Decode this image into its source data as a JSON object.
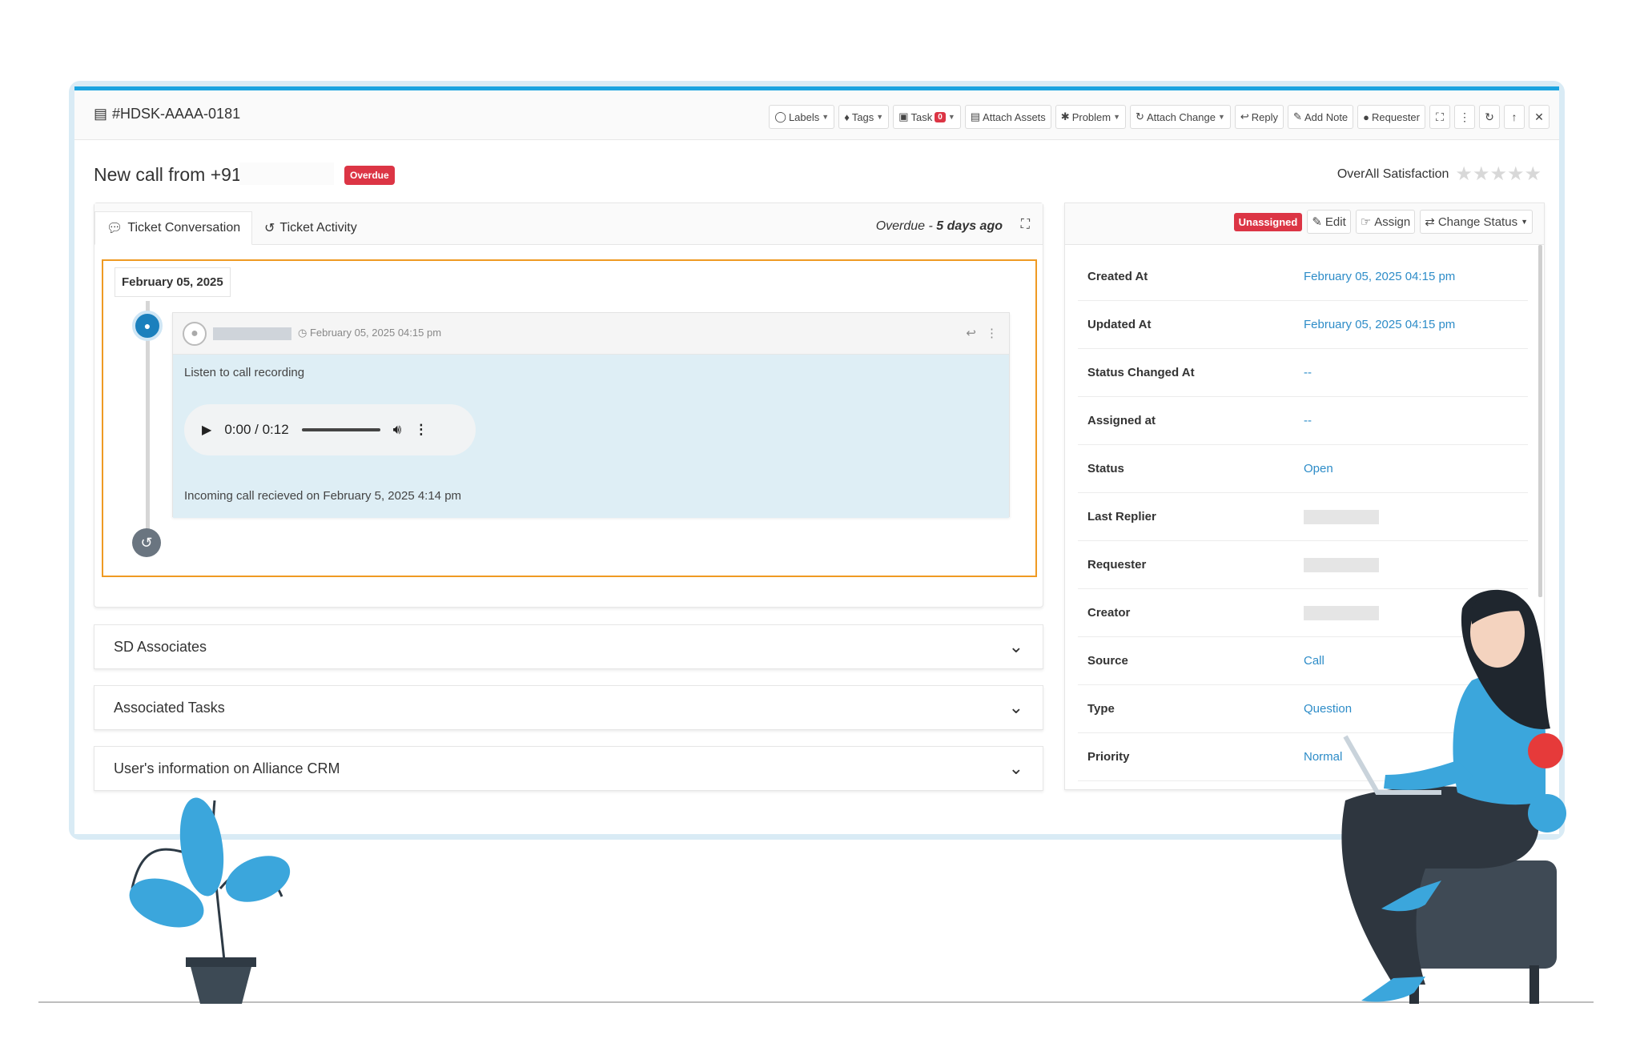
{
  "header": {
    "ticket_id": "#HDSK-AAAA-0181",
    "toolbar": {
      "labels": "Labels",
      "tags": "Tags",
      "task": "Task",
      "task_count": "0",
      "attach_assets": "Attach Assets",
      "problem": "Problem",
      "attach_change": "Attach Change",
      "reply": "Reply",
      "add_note": "Add Note",
      "requester": "Requester"
    }
  },
  "subject": {
    "title": "New call from +91",
    "status_badge": "Overdue",
    "satisfaction_label": "OverAll Satisfaction",
    "rating_stars": 0
  },
  "conversation": {
    "tabs": [
      "Ticket Conversation",
      "Ticket Activity"
    ],
    "overdue_prefix": "Overdue - ",
    "overdue_duration": "5 days ago",
    "date_label": "February 05, 2025",
    "message": {
      "timestamp": "February 05, 2025 04:15 pm",
      "title": "Listen to call recording",
      "audio_time": "0:00 / 0:12",
      "footer": "Incoming call recieved on February 5, 2025 4:14 pm"
    }
  },
  "accordions": [
    "SD Associates",
    "Associated Tasks",
    "User's information on Alliance CRM"
  ],
  "details": {
    "assignment_badge": "Unassigned",
    "edit": "Edit",
    "assign": "Assign",
    "change_status": "Change Status",
    "rows": [
      {
        "label": "Created At",
        "value": "February 05, 2025 04:15 pm"
      },
      {
        "label": "Updated At",
        "value": "February 05, 2025 04:15 pm"
      },
      {
        "label": "Status Changed At",
        "value": "--"
      },
      {
        "label": "Assigned at",
        "value": "--"
      },
      {
        "label": "Status",
        "value": "Open"
      },
      {
        "label": "Last Replier",
        "value": ""
      },
      {
        "label": "Requester",
        "value": ""
      },
      {
        "label": "Creator",
        "value": ""
      },
      {
        "label": "Source",
        "value": "Call"
      },
      {
        "label": "Type",
        "value": "Question"
      },
      {
        "label": "Priority",
        "value": "Normal"
      }
    ]
  },
  "colors": {
    "accent": "#1aa3e0",
    "danger": "#dc3545",
    "link": "#2d8cc8",
    "highlight": "#ef9a23",
    "message_bg": "#deeef5"
  }
}
